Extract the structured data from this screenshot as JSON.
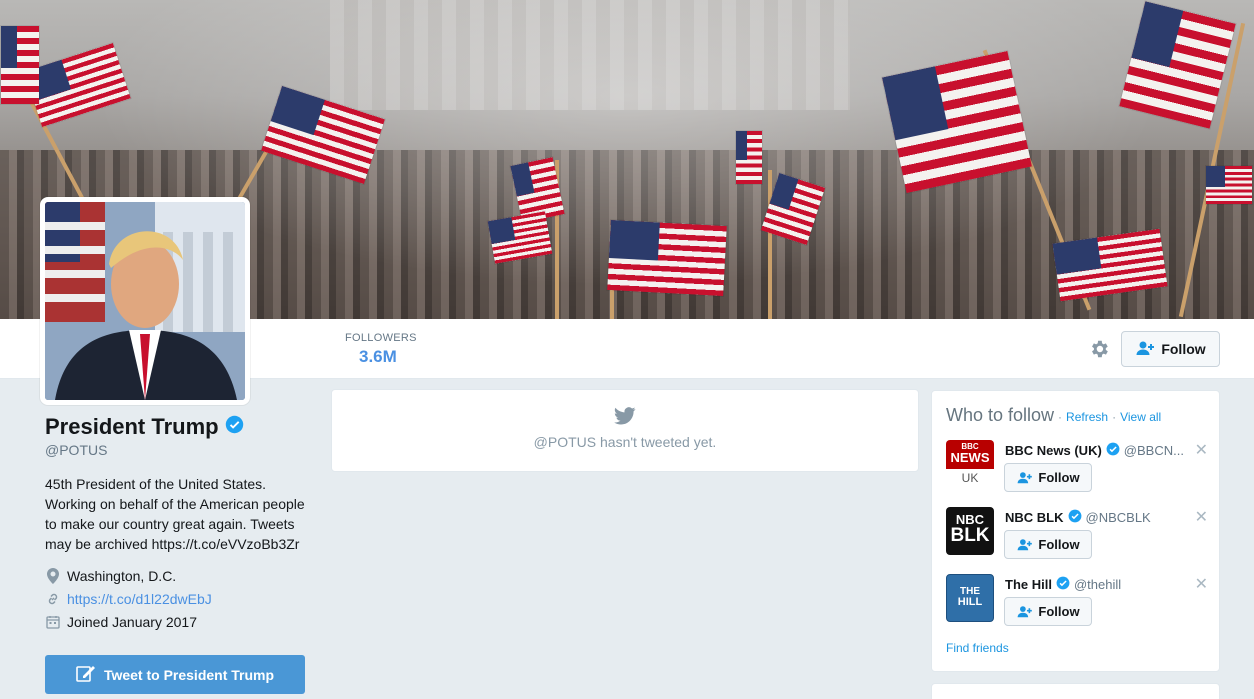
{
  "profile": {
    "name": "President Trump",
    "handle": "@POTUS",
    "bio": "45th President of the United States. Working on behalf of the American people to make our country great again. Tweets may be archived https://t.co/eVVzoBb3Zr",
    "location": "Washington, D.C.",
    "website": "https://t.co/d1l22dwEbJ",
    "joined": "Joined January 2017",
    "tweet_to_label": "Tweet to President Trump"
  },
  "nav": {
    "followers_label": "FOLLOWERS",
    "followers_value": "3.6M",
    "follow_label": "Follow"
  },
  "timeline": {
    "empty_text": "@POTUS hasn't tweeted yet."
  },
  "who_to_follow": {
    "title": "Who to follow",
    "refresh_label": "Refresh",
    "view_all_label": "View all",
    "separator": "·",
    "find_friends_label": "Find friends",
    "suggestions": [
      {
        "name": "BBC News (UK)",
        "handle": "@BBCN...",
        "follow_label": "Follow",
        "logo_lines": [
          "BBC",
          "NEWS",
          "UK"
        ]
      },
      {
        "name": "NBC BLK",
        "handle": "@NBCBLK",
        "follow_label": "Follow",
        "logo_lines": [
          "NBC",
          "BLK"
        ]
      },
      {
        "name": "The Hill",
        "handle": "@thehill",
        "follow_label": "Follow",
        "logo_lines": [
          "THE",
          "HILL"
        ]
      }
    ]
  },
  "colors": {
    "accent": "#4a90e2",
    "link": "#1b95e0",
    "tweet_button": "#4a97d6",
    "verified": "#1da1f2"
  },
  "icons": {
    "verified": "verified-badge-icon",
    "gear": "gear-icon",
    "add_user": "add-user-icon",
    "twitter_bird": "twitter-bird-icon",
    "location": "location-pin-icon",
    "link": "link-icon",
    "calendar": "calendar-icon",
    "close": "close-icon",
    "compose": "compose-icon"
  }
}
